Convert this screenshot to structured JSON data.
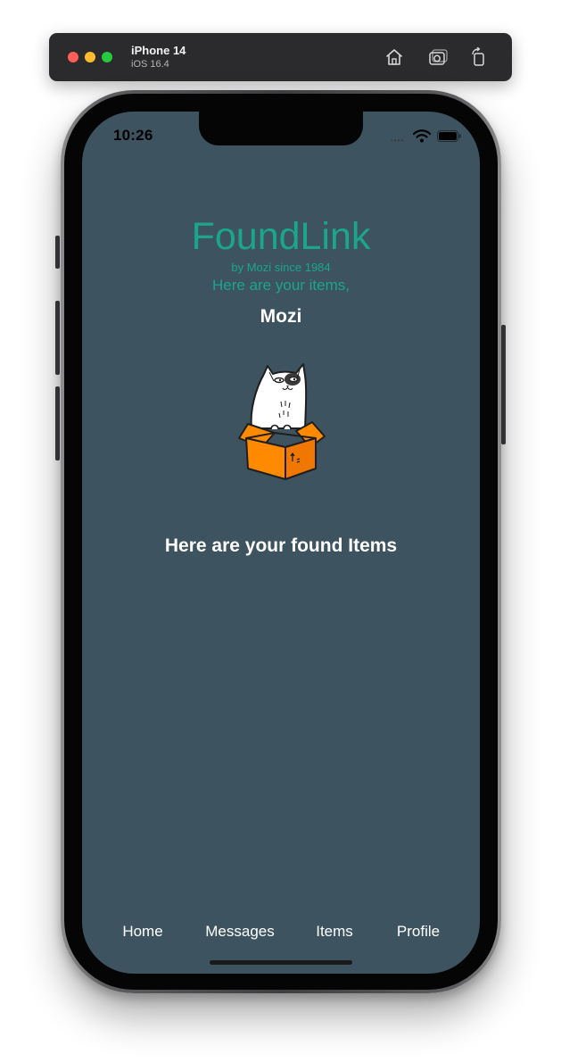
{
  "simulator": {
    "device_name": "iPhone 14",
    "os_version": "iOS 16.4",
    "buttons": [
      "home-icon",
      "screenshot-icon",
      "rotate-icon"
    ]
  },
  "status_bar": {
    "time": "10:26"
  },
  "app": {
    "title": "FoundLink",
    "byline": "by Mozi since 1984",
    "intro": "Here are your items,",
    "user_name": "Mozi",
    "section_heading": "Here are your found Items",
    "accent_color": "#1ba58a",
    "background_color": "#3d5360",
    "box_color": "#ff8a00"
  },
  "tabs": [
    {
      "label": "Home"
    },
    {
      "label": "Messages"
    },
    {
      "label": "Items"
    },
    {
      "label": "Profile"
    }
  ]
}
